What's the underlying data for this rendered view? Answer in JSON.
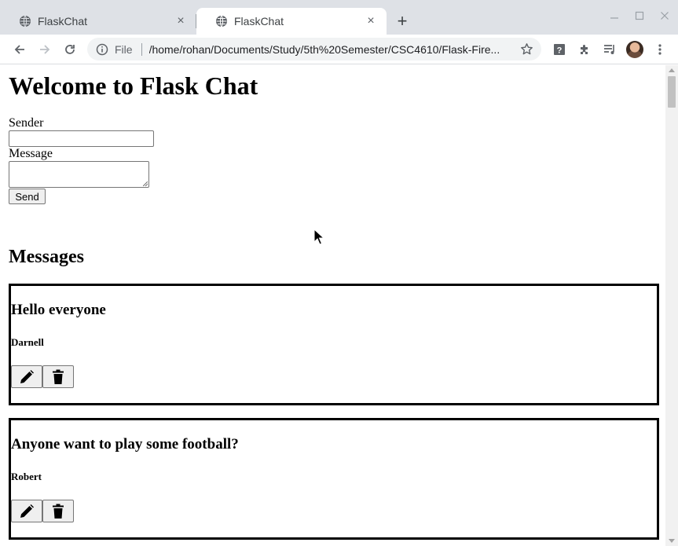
{
  "browser": {
    "tabs": [
      {
        "title": "FlaskChat",
        "active": false
      },
      {
        "title": "FlaskChat",
        "active": true
      }
    ],
    "close_glyph": "×",
    "new_tab_glyph": "+",
    "address": {
      "scheme": "File",
      "url": "/home/rohan/Documents/Study/5th%20Semester/CSC4610/Flask-Fire..."
    },
    "icons": [
      "back-icon",
      "forward-icon",
      "reload-icon",
      "info-icon",
      "star-icon",
      "help-extension-icon",
      "extensions-puzzle-icon",
      "media-queue-icon",
      "profile-avatar",
      "menu-kebab-icon"
    ]
  },
  "page": {
    "heading": "Welcome to Flask Chat",
    "form": {
      "sender_label": "Sender",
      "sender_value": "",
      "message_label": "Message",
      "message_value": "",
      "send_label": "Send"
    },
    "messages_heading": "Messages",
    "messages": [
      {
        "text": "Hello everyone",
        "sender": "Darnell"
      },
      {
        "text": "Anyone want to play some football?",
        "sender": "Robert"
      }
    ]
  }
}
